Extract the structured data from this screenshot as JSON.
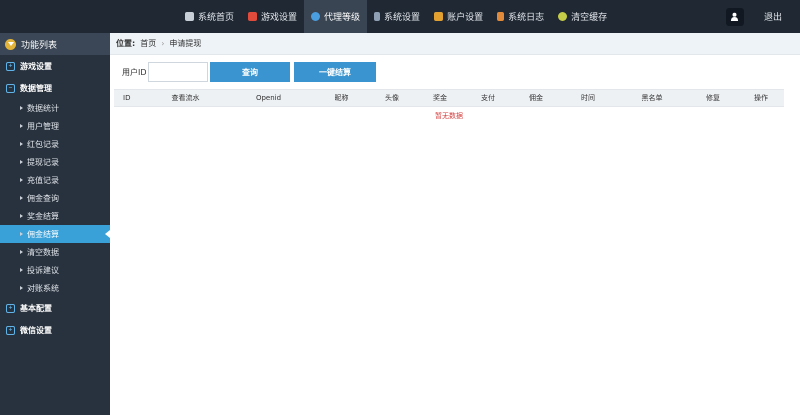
{
  "topbar": {
    "nav": [
      {
        "label": "系统首页",
        "icon": "home-icon",
        "color": "#c8ced6"
      },
      {
        "label": "游戏设置",
        "icon": "game-icon",
        "color": "#e14b3b"
      },
      {
        "label": "代理等级",
        "icon": "agent-level-icon",
        "color": "#4a9fe0",
        "active": true
      },
      {
        "label": "系统设置",
        "icon": "settings-icon",
        "color": "#8fa0b4"
      },
      {
        "label": "账户设置",
        "icon": "account-icon",
        "color": "#e2a030"
      },
      {
        "label": "系统日志",
        "icon": "log-icon",
        "color": "#e08a3a"
      },
      {
        "label": "清空缓存",
        "icon": "clear-cache-icon",
        "color": "#c5cc47"
      }
    ],
    "logout": "退出"
  },
  "sidebar": {
    "header": "功能列表",
    "groups": [
      {
        "label": "游戏设置"
      },
      {
        "label": "数据管理"
      },
      {
        "label": "基本配置"
      },
      {
        "label": "微信设置"
      }
    ],
    "items": [
      {
        "label": "数据统计"
      },
      {
        "label": "用户管理"
      },
      {
        "label": "红包记录"
      },
      {
        "label": "提现记录"
      },
      {
        "label": "充值记录"
      },
      {
        "label": "佣金查询"
      },
      {
        "label": "奖金结算"
      },
      {
        "label": "佣金结算",
        "active": true
      },
      {
        "label": "清空数据"
      },
      {
        "label": "投诉建议"
      },
      {
        "label": "对账系统"
      }
    ]
  },
  "breadcrumb": {
    "label": "位置:",
    "home": "首页",
    "separator": "›",
    "current": "申请提现"
  },
  "search": {
    "label": "用户ID",
    "value": "",
    "placeholder": "",
    "query_button": "查询",
    "settle_button": "一键结算"
  },
  "table": {
    "columns": [
      "ID",
      "查看流水",
      "Openid",
      "昵称",
      "头像",
      "奖金",
      "支付",
      "佣金",
      "时间",
      "黑名单",
      "修复",
      "操作"
    ],
    "empty_text": "暂无数据"
  },
  "colors": {
    "topbar": "#1f2833",
    "sidebar": "#28323e",
    "accent": "#3a94cf",
    "active_item": "#3aa0d8"
  }
}
